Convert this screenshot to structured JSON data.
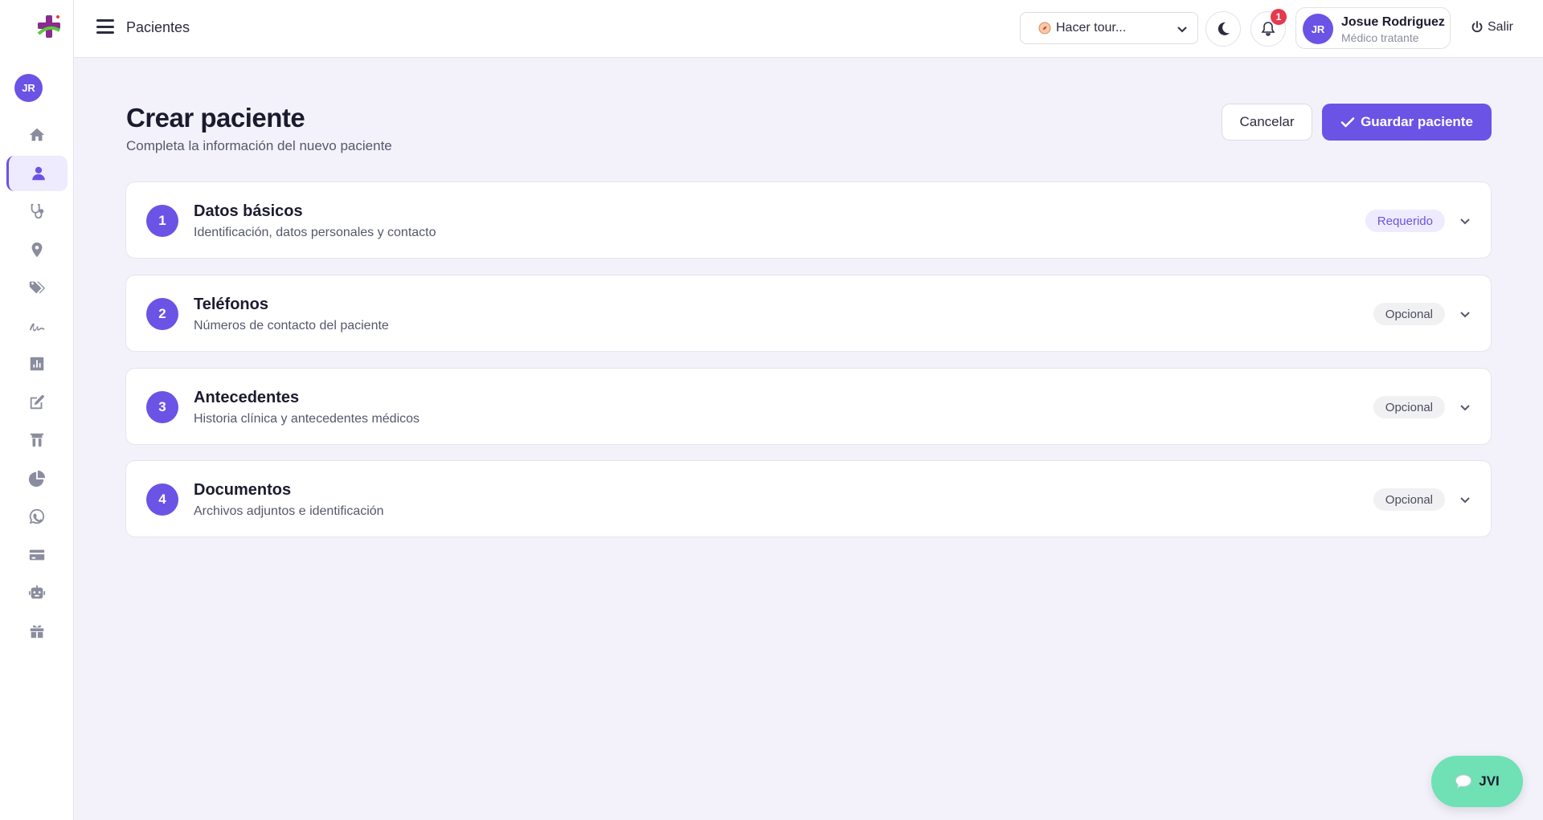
{
  "sidebar": {
    "avatar_initials": "JR",
    "nav_items": [
      {
        "icon": "home-icon",
        "active": false
      },
      {
        "icon": "user-icon",
        "active": true
      },
      {
        "icon": "stethoscope-icon",
        "active": false
      },
      {
        "icon": "map-pin-icon",
        "active": false
      },
      {
        "icon": "tags-icon",
        "active": false
      },
      {
        "icon": "signature-icon",
        "active": false
      },
      {
        "icon": "bar-chart-icon",
        "active": false
      },
      {
        "icon": "edit-icon",
        "active": false
      },
      {
        "icon": "test-tubes-icon",
        "active": false
      },
      {
        "icon": "pie-chart-icon",
        "active": false
      },
      {
        "icon": "whatsapp-icon",
        "active": false
      },
      {
        "icon": "credit-card-icon",
        "active": false
      },
      {
        "icon": "robot-icon",
        "active": false
      },
      {
        "icon": "gift-icon",
        "active": false
      }
    ]
  },
  "header": {
    "title": "Pacientes",
    "tour_select": "Hacer tour...",
    "notification_count": "1",
    "user": {
      "initials": "JR",
      "name": "Josue Rodriguez",
      "role": "Médico tratante"
    },
    "logout_label": "Salir"
  },
  "main": {
    "title": "Crear paciente",
    "subtitle": "Completa la información del nuevo paciente",
    "cancel_label": "Cancelar",
    "save_label": "Guardar paciente",
    "sections": [
      {
        "number": "1",
        "title": "Datos básicos",
        "description": "Identificación, datos personales y contacto",
        "badge": "Requerido"
      },
      {
        "number": "2",
        "title": "Teléfonos",
        "description": "Números de contacto del paciente",
        "badge": "Opcional"
      },
      {
        "number": "3",
        "title": "Antecedentes",
        "description": "Historia clínica y antecedentes médicos",
        "badge": "Opcional"
      },
      {
        "number": "4",
        "title": "Documentos",
        "description": "Archivos adjuntos e identificación",
        "badge": "Opcional"
      }
    ]
  },
  "chat": {
    "label": "JVI"
  },
  "colors": {
    "accent": "#6b53e6",
    "chat": "#6fe1b5",
    "badge_alert": "#e53a4d"
  }
}
